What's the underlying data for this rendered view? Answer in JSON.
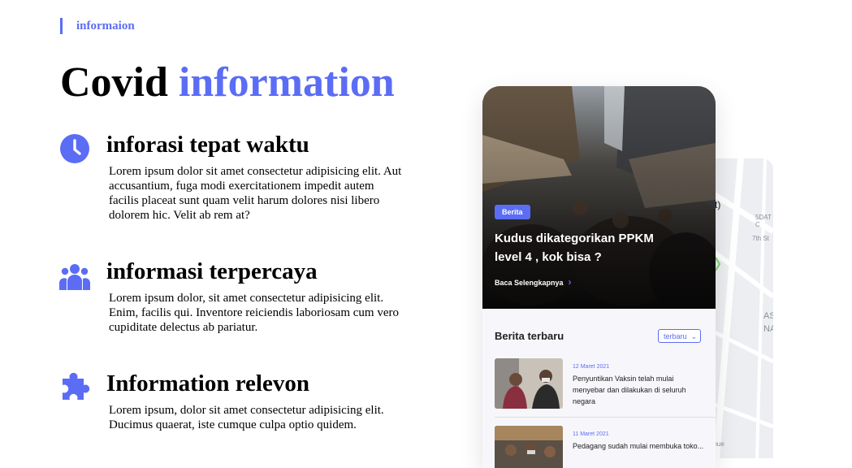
{
  "eyebrow": "informaion",
  "title": {
    "main": "Covid",
    "accent": "information"
  },
  "features": [
    {
      "icon": "clock-icon",
      "title": "inforasi tepat waktu",
      "text": "Lorem ipsum dolor sit amet consectetur adipisicing elit. Aut accusantium, fuga modi exercitationem impedit autem facilis placeat sunt quam velit harum dolores nisi libero dolorem hic. Velit ab rem at?"
    },
    {
      "icon": "users-icon",
      "title": "informasi terpercaya",
      "text": "Lorem ipsum dolor, sit amet consectetur adipisicing elit. Enim, facilis qui. Inventore reiciendis laboriosam cum vero cupiditate delectus ab pariatur."
    },
    {
      "icon": "puzzle-icon",
      "title": "Information relevon",
      "text": "Lorem ipsum, dolor sit amet consectetur adipisicing elit. Ducimus quaerat, iste cumque culpa optio quidem."
    }
  ],
  "phone": {
    "hero": {
      "badge": "Berita",
      "title": "Kudus dikategorikan PPKM level 4 , kok bisa ?",
      "read_more": "Baca Selengkapnya"
    },
    "section_title": "Berita terbaru",
    "sort_label": "terbaru",
    "news": [
      {
        "date": "12 Maret 2021",
        "headline": "Penyuntikan Vaksin telah mulai menyebar dan dilakukan di seluruh negara"
      },
      {
        "date": "11 Maret 2021",
        "headline": "Pedagang sudah mulai membuka toko..."
      }
    ]
  },
  "map": {
    "labels": [
      "t)",
      "5DAT C",
      "7th St",
      "AS",
      "NA",
      "enue"
    ]
  },
  "colors": {
    "accent": "#5b6cf5",
    "text": "#000000"
  }
}
